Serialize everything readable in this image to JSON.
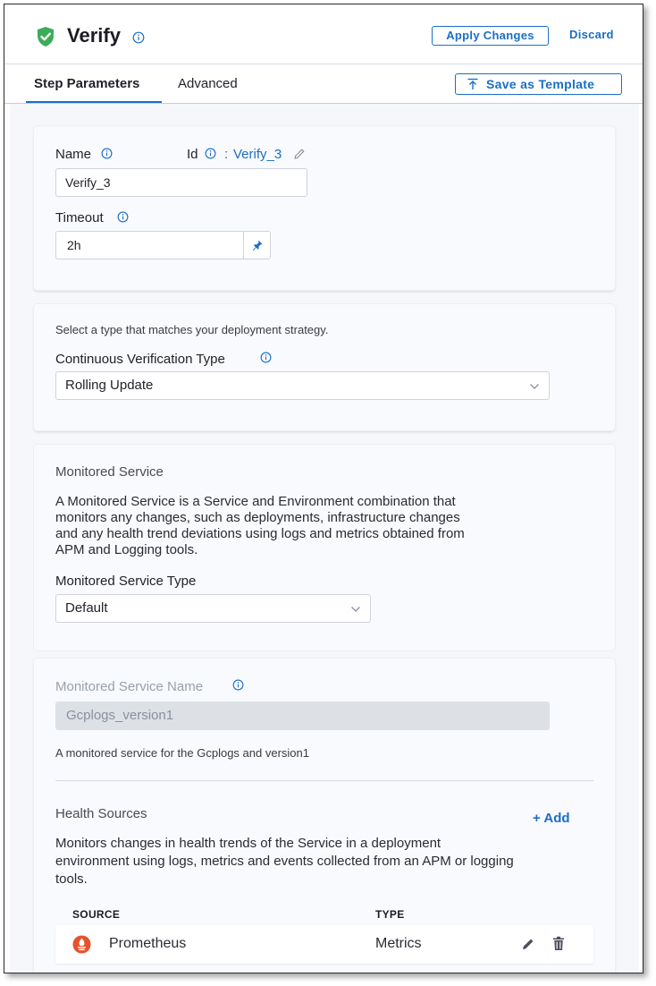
{
  "header": {
    "title": "Verify",
    "apply_label": "Apply Changes",
    "discard_label": "Discard",
    "status_color": "#3dac5a"
  },
  "tabs": {
    "step_parameters": "Step Parameters",
    "advanced": "Advanced",
    "save_template": "Save as Template"
  },
  "basic": {
    "name_label": "Name",
    "id_label": "Id",
    "id_sep": ":",
    "id_value": "Verify_3",
    "name_value": "Verify_3",
    "timeout_label": "Timeout",
    "timeout_value": "2h"
  },
  "cv": {
    "hint": "Select a type that matches your deployment strategy.",
    "type_label": "Continuous Verification Type",
    "type_value": "Rolling Update"
  },
  "monitored_service": {
    "heading": "Monitored Service",
    "description_lines": [
      "A Monitored Service is a Service and Environment combination that",
      "monitors any changes, such as deployments, infrastructure changes",
      "and any health trend deviations using logs and metrics obtained from",
      "APM and Logging tools."
    ],
    "type_label": "Monitored Service Type",
    "type_value": "Default",
    "name_label": "Monitored Service Name",
    "name_value": "Gcplogs_version1",
    "name_hint": "A monitored service for the Gcplogs and version1"
  },
  "health_sources": {
    "heading": "Health Sources",
    "add_label": "+ Add",
    "description_lines": [
      "Monitors changes in health trends of the Service in a deployment",
      "environment using logs, metrics and events collected from an APM or logging",
      "tools."
    ],
    "columns": [
      "SOURCE",
      "TYPE"
    ],
    "rows": [
      {
        "source": "Prometheus",
        "type": "Metrics",
        "icon": "prometheus-icon"
      }
    ]
  },
  "colors": {
    "accent": "#1a6ec7",
    "prometheus": "#e6522c"
  }
}
